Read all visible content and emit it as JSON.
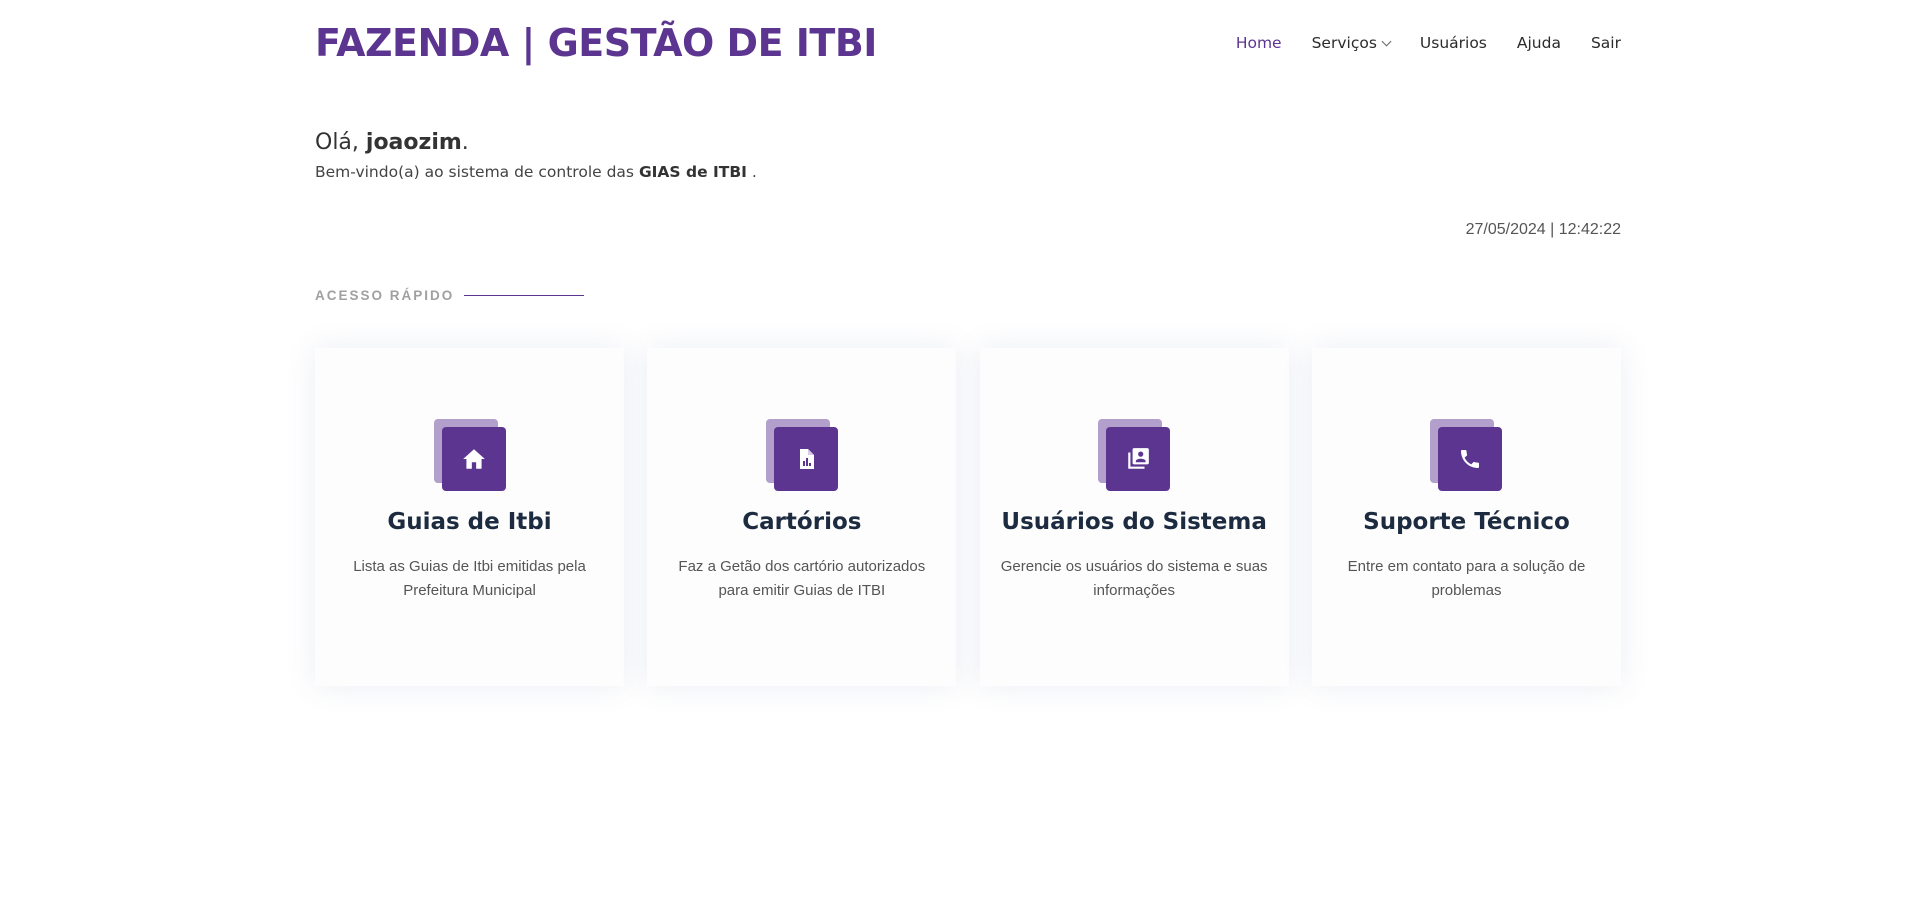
{
  "header": {
    "logo": "FAZENDA | GESTÃO DE ITBI",
    "nav": [
      {
        "label": "Home",
        "active": true
      },
      {
        "label": "Serviços",
        "has_dropdown": true
      },
      {
        "label": "Usuários"
      },
      {
        "label": "Ajuda"
      },
      {
        "label": "Sair"
      }
    ]
  },
  "greeting": {
    "hello_prefix": "Olá, ",
    "username": "joaozim",
    "hello_suffix": ".",
    "welcome_prefix": "Bem-vindo(a) ao sistema de controle das ",
    "welcome_bold": "GIAS de ITBI",
    "welcome_suffix": " ."
  },
  "datetime": "27/05/2024 | 12:42:22",
  "section": {
    "label": "ACESSO RÁPIDO"
  },
  "cards": [
    {
      "icon": "home-icon",
      "title": "Guias de Itbi",
      "description": "Lista as Guias de Itbi emitidas pela Prefeitura Municipal"
    },
    {
      "icon": "document-chart-icon",
      "title": "Cartórios",
      "description": "Faz a Getão dos cartório autorizados para emitir Guias de ITBI"
    },
    {
      "icon": "contacts-book-icon",
      "title": "Usuários do Sistema",
      "description": "Gerencie os usuários do sistema e suas informações"
    },
    {
      "icon": "phone-icon",
      "title": "Suporte Técnico",
      "description": "Entre em contato para a solução de problemas"
    }
  ],
  "colors": {
    "brand": "#5c3591",
    "brand_light": "#b29fcc",
    "card_title": "#1c2b3f"
  }
}
